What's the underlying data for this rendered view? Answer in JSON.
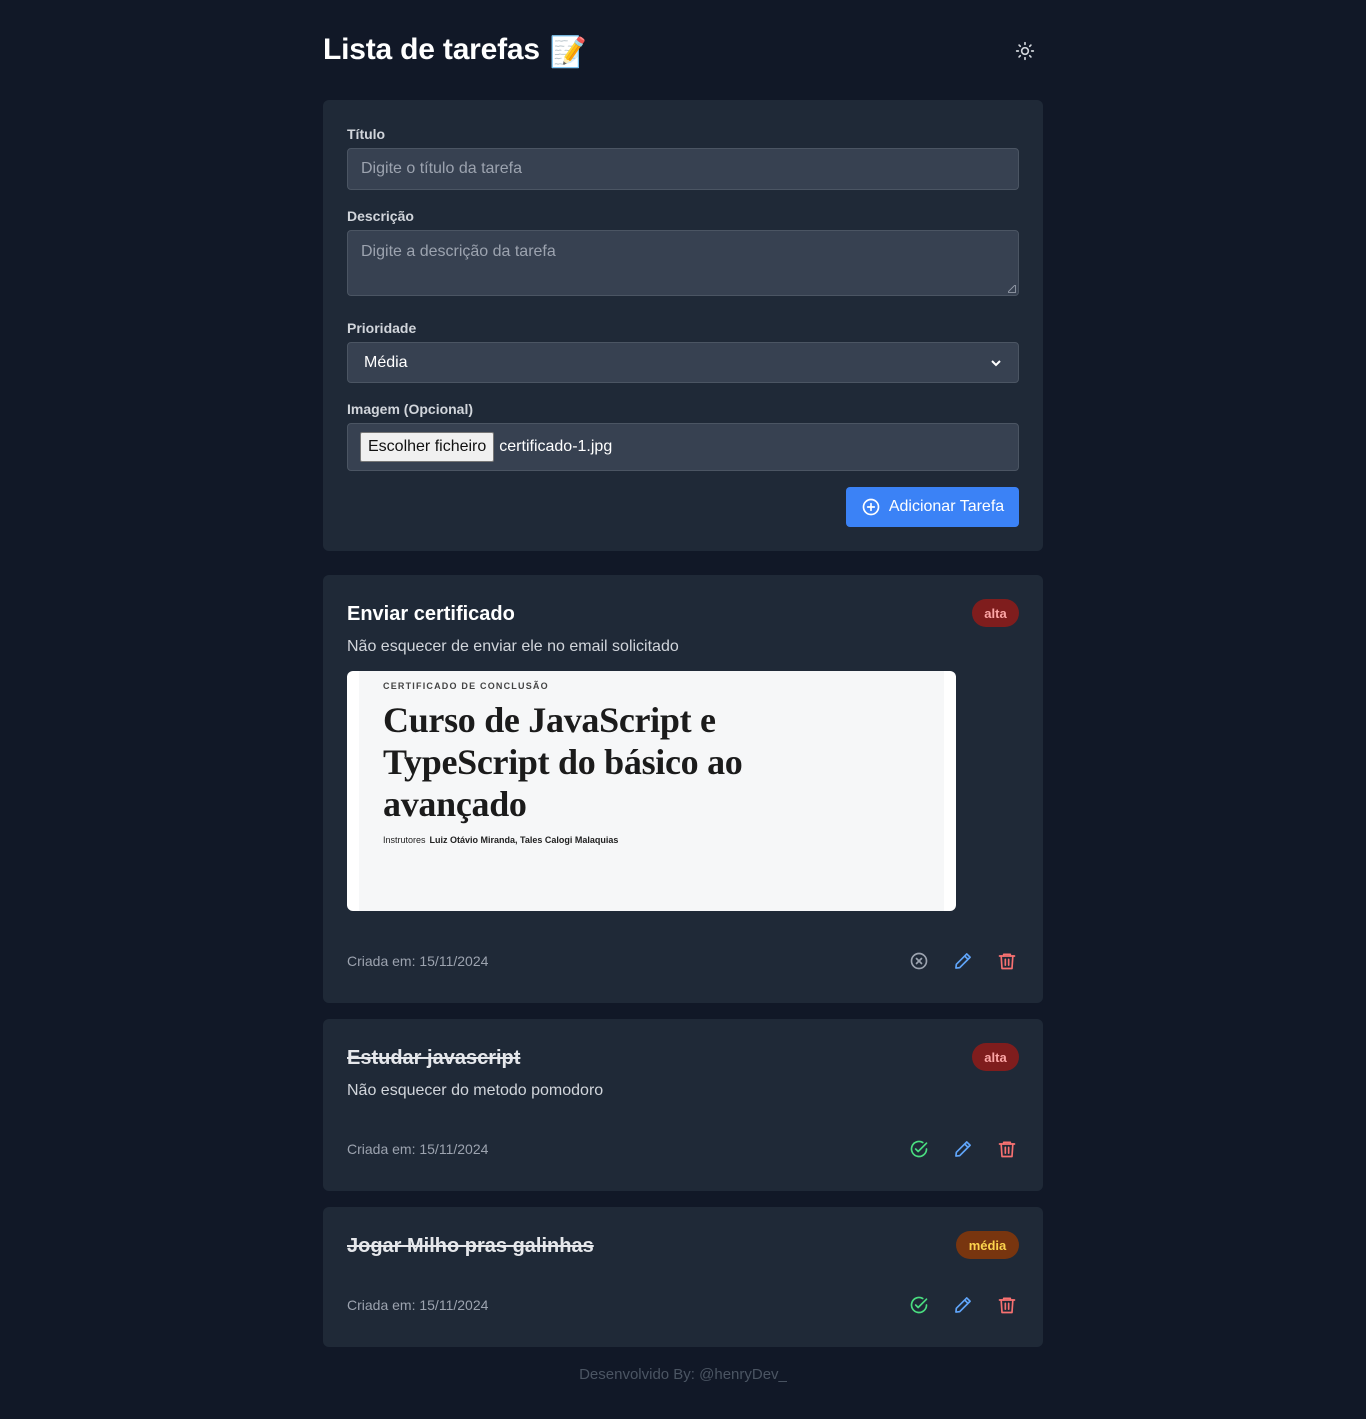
{
  "header": {
    "title": "Lista de tarefas",
    "title_emoji": "📝",
    "theme_toggle_icon": "sun-icon"
  },
  "form": {
    "title_label": "Título",
    "title_placeholder": "Digite o título da tarefa",
    "description_label": "Descrição",
    "description_placeholder": "Digite a descrição da tarefa",
    "priority_label": "Prioridade",
    "priority_selected": "Média",
    "image_label": "Imagem (Opcional)",
    "file_button_label": "Escolher ficheiro",
    "file_name": "certificado-1.jpg",
    "submit_label": "Adicionar Tarefa"
  },
  "tasks": [
    {
      "title": "Enviar certificado",
      "priority": "alta",
      "description": "Não esquecer de enviar ele no email solicitado",
      "created": "Criada em: 15/11/2024",
      "completed": false,
      "image": {
        "kicker": "CERTIFICADO DE CONCLUSÃO",
        "heading": "Curso de JavaScript e TypeScript do básico ao avançado",
        "instructors_label": "Instrutores",
        "instructors": "Luiz Otávio Miranda,  Tales Calogi Malaquias"
      },
      "status_icon": "x-circle-icon"
    },
    {
      "title": "Estudar javascript",
      "priority": "alta",
      "description": "Não esquecer do metodo pomodoro",
      "created": "Criada em: 15/11/2024",
      "completed": true,
      "status_icon": "check-circle-icon"
    },
    {
      "title": "Jogar Milho pras galinhas",
      "priority": "média",
      "created": "Criada em: 15/11/2024",
      "completed": true,
      "status_icon": "check-circle-icon"
    }
  ],
  "colors": {
    "background": "#111827",
    "card": "#1f2937",
    "accent": "#3b82f6",
    "danger": "#f87171",
    "success": "#4ade80"
  },
  "footer": {
    "text": "Desenvolvido By: @henryDev_"
  }
}
